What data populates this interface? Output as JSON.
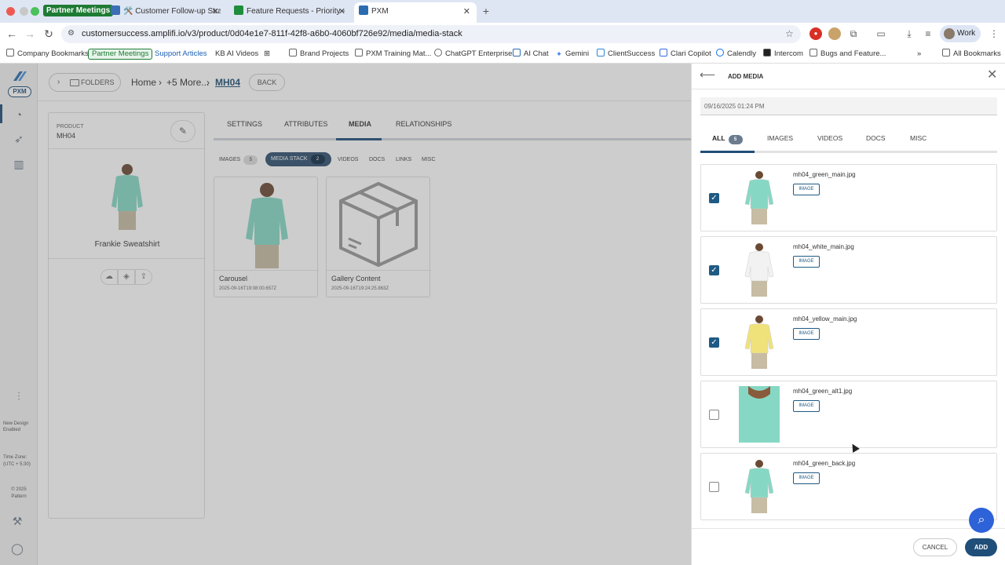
{
  "browser": {
    "tab_group_label": "Partner Meetings",
    "tabs": [
      {
        "label": "🛠️ Customer Follow-up Strat"
      },
      {
        "label": "Feature Requests - Priority -"
      },
      {
        "label": "PXM"
      }
    ],
    "new_tab_symbol": "+",
    "url": "customersuccess.amplifi.io/v3/product/0d04e1e7-811f-42f8-a6b0-4060bf726e92/media/media-stack",
    "profile_label": "Work",
    "bookmarks": [
      "Company Bookmarks",
      "Partner Meetings",
      "Support Articles",
      "KB AI Videos",
      "Brand Projects",
      "PXM Training Mat...",
      "ChatGPT Enterprise",
      "AI Chat",
      "Gemini",
      "ClientSuccess",
      "Clari Copilot",
      "Calendly",
      "Intercom",
      "Bugs and Feature..."
    ],
    "all_bookmarks_label": "All Bookmarks",
    "more_symbol": "»"
  },
  "leftnav": {
    "logo_badge": "PXM",
    "new_design_label": "New Design",
    "new_design_value": "Enabled",
    "timezone_label": "Time Zone:",
    "timezone_value": "(UTC + 5:30)",
    "copyright": "© 2025",
    "copyright_company": "Pattern"
  },
  "breadcrumb": {
    "folders_label": "FOLDERS",
    "home": "Home",
    "sep1": "›",
    "more": "+5 More...",
    "sep2": "›",
    "current": "MH04",
    "back_label": "BACK"
  },
  "product": {
    "label": "PRODUCT",
    "code": "MH04",
    "name": "Frankie Sweatshirt"
  },
  "main_tabs": [
    "SETTINGS",
    "ATTRIBUTES",
    "MEDIA",
    "RELATIONSHIPS"
  ],
  "sub_tabs": {
    "images_label": "IMAGES",
    "images_count": "5",
    "mediastack_label": "MEDIA STACK",
    "mediastack_count": "2",
    "videos_label": "VIDEOS",
    "docs_label": "DOCS",
    "links_label": "LINKS",
    "misc_label": "MISC"
  },
  "media_cards": [
    {
      "title": "Carousel",
      "date": "2025-09-16T19:08:00.657Z"
    },
    {
      "title": "Gallery Content",
      "date": "2025-09-16T19:24:25.863Z"
    }
  ],
  "panel": {
    "title": "ADD MEDIA",
    "date_value": "09/16/2025 01:24 PM",
    "tabs": {
      "all_label": "ALL",
      "all_count": "5",
      "images_label": "IMAGES",
      "videos_label": "VIDEOS",
      "docs_label": "DOCS",
      "misc_label": "MISC"
    },
    "items": [
      {
        "filename": "mh04_green_main.jpg",
        "type": "IMAGE",
        "checked": true,
        "color": "#86d8c4"
      },
      {
        "filename": "mh04_white_main.jpg",
        "type": "IMAGE",
        "checked": true,
        "color": "#f2f2f2"
      },
      {
        "filename": "mh04_yellow_main.jpg",
        "type": "IMAGE",
        "checked": true,
        "color": "#f0e27a"
      },
      {
        "filename": "mh04_green_alt1.jpg",
        "type": "IMAGE",
        "checked": false,
        "color": "#86d8c4"
      },
      {
        "filename": "mh04_green_back.jpg",
        "type": "IMAGE",
        "checked": false,
        "color": "#86d8c4"
      }
    ],
    "cancel_label": "CANCEL",
    "add_label": "ADD"
  }
}
